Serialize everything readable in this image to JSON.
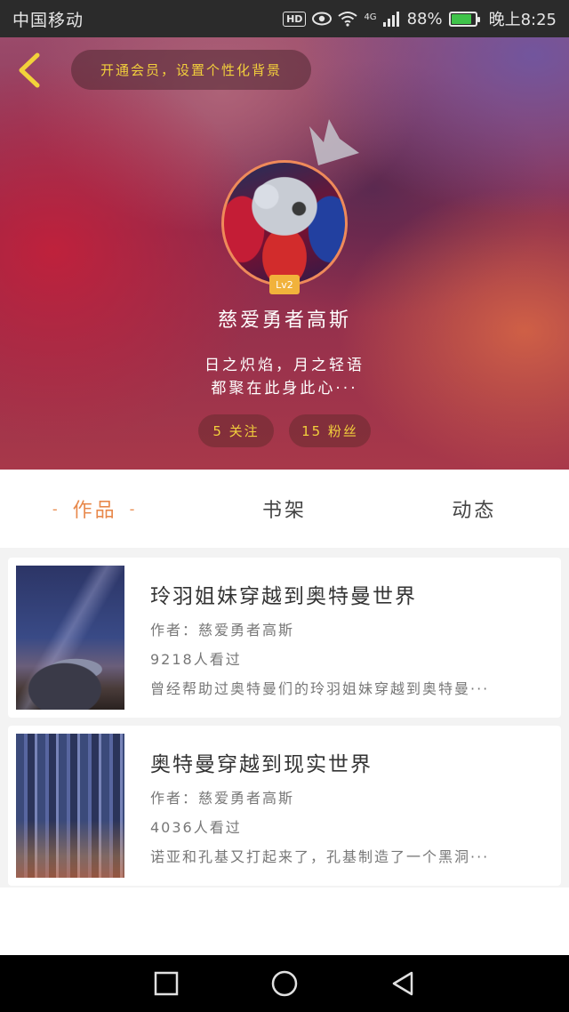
{
  "status_bar": {
    "carrier": "中国移动",
    "hd": "HD",
    "network": "4G",
    "battery": "88%",
    "time": "晚上8:25"
  },
  "header": {
    "vip_prompt": "开通会员，设置个性化背景",
    "level": "Lv2",
    "username": "慈爱勇者高斯",
    "bio_line1": "日之炽焰，月之轻语",
    "bio_line2": "都聚在此身此心···",
    "following": "5 关注",
    "followers": "15 粉丝"
  },
  "tabs": [
    {
      "label": "作品",
      "active": true
    },
    {
      "label": "书架",
      "active": false
    },
    {
      "label": "动态",
      "active": false
    }
  ],
  "books": [
    {
      "title": "玲羽姐妹穿越到奥特曼世界",
      "author": "作者：慈爱勇者高斯",
      "views": "9218人看过",
      "description": "曾经帮助过奥特曼们的玲羽姐妹穿越到奥特曼···"
    },
    {
      "title": "奥特曼穿越到现实世界",
      "author": "作者：慈爱勇者高斯",
      "views": "4036人看过",
      "description": "诺亚和孔基又打起来了，孔基制造了一个黑洞···"
    }
  ],
  "colors": {
    "accent": "#e8894c",
    "gold": "#f2cf3c",
    "level_badge": "#f1b23b"
  },
  "icons": {
    "back": "chevron-left-icon",
    "crown": "crown-icon",
    "nav_recent": "square-icon",
    "nav_home": "circle-icon",
    "nav_back": "triangle-back-icon"
  }
}
